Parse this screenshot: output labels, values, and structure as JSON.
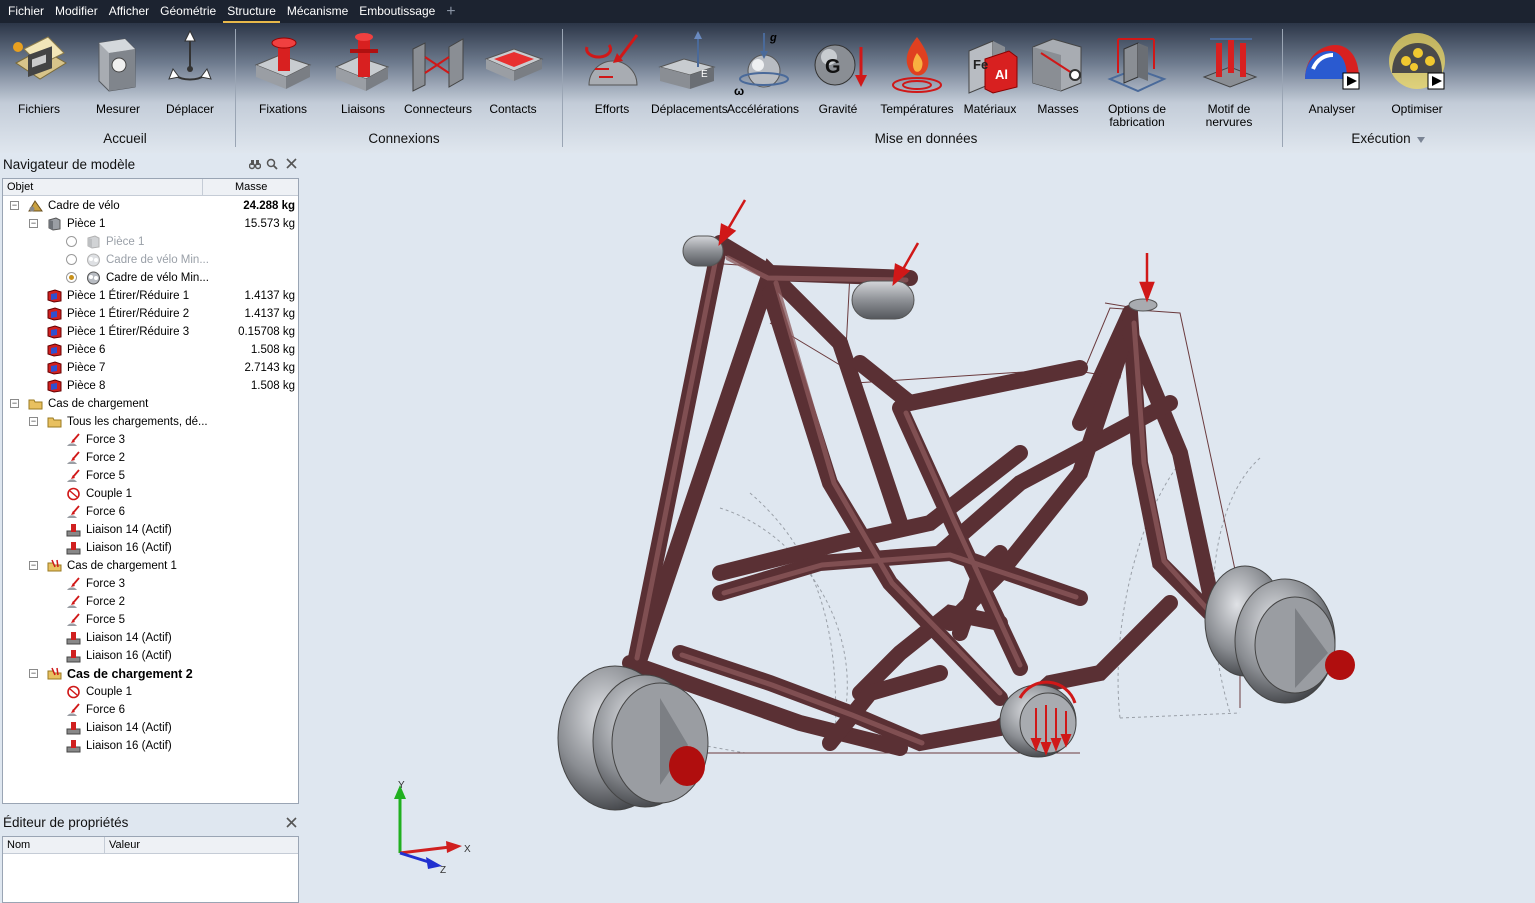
{
  "menu": {
    "items": [
      "Fichier",
      "Modifier",
      "Afficher",
      "Géométrie",
      "Structure",
      "Mécanisme",
      "Emboutissage"
    ],
    "active_index": 4,
    "plus": "+"
  },
  "ribbon": {
    "buttons": {
      "fichiers": "Fichiers",
      "mesurer": "Mesurer",
      "deplacer": "Déplacer",
      "fixations": "Fixations",
      "liaisons": "Liaisons",
      "connecteurs": "Connecteurs",
      "contacts": "Contacts",
      "efforts": "Efforts",
      "deplacements": "Déplacements",
      "accelerations": "Accélérations",
      "gravite": "Gravité",
      "temperatures": "Températures",
      "materiaux": "Matériaux",
      "masses": "Masses",
      "options_fabrication": "Options de fabrication",
      "motif_nervures": "Motif de nervures",
      "analyser": "Analyser",
      "optimiser": "Optimiser"
    },
    "groups": {
      "accueil": "Accueil",
      "connexions": "Connexions",
      "mise": "Mise en données",
      "execution": "Exécution"
    },
    "glyphs": {
      "omega": "ω",
      "g": "g",
      "G": "G",
      "Fe": "Fe",
      "Al": "Al"
    }
  },
  "navigator": {
    "title": "Navigateur de modèle",
    "col_object": "Objet",
    "col_mass": "Masse",
    "rows": [
      {
        "label": "Cadre de vélo",
        "mass": "24.288 kg",
        "level": 0,
        "toggle": "−",
        "icon": "bike-frame-icon",
        "mass_bold": true
      },
      {
        "label": "Pièce 1",
        "mass": "15.573 kg",
        "level": 1,
        "toggle": "−",
        "icon": "gray-part-icon"
      },
      {
        "label": "Pièce 1",
        "mass": "",
        "level": 2,
        "toggle": "",
        "icon": "gray-part-icon",
        "radio": "off",
        "disabled": true
      },
      {
        "label": "Cadre de vélo Min...",
        "mass": "",
        "level": 2,
        "toggle": "",
        "icon": "mesh-part-icon",
        "radio": "off",
        "disabled": true
      },
      {
        "label": "Cadre de vélo Min...",
        "mass": "",
        "level": 2,
        "toggle": "",
        "icon": "mesh-part-icon",
        "radio": "on"
      },
      {
        "label": "Pièce 1 Étirer/Réduire 1",
        "mass": "1.4137 kg",
        "level": 1,
        "toggle": "",
        "icon": "design-part-icon"
      },
      {
        "label": "Pièce 1 Étirer/Réduire 2",
        "mass": "1.4137 kg",
        "level": 1,
        "toggle": "",
        "icon": "design-part-icon"
      },
      {
        "label": "Pièce 1 Étirer/Réduire 3",
        "mass": "0.15708 kg",
        "level": 1,
        "toggle": "",
        "icon": "design-part-icon"
      },
      {
        "label": "Pièce 6",
        "mass": "1.508 kg",
        "level": 1,
        "toggle": "",
        "icon": "design-part-icon"
      },
      {
        "label": "Pièce 7",
        "mass": "2.7143 kg",
        "level": 1,
        "toggle": "",
        "icon": "design-part-icon"
      },
      {
        "label": "Pièce 8",
        "mass": "1.508 kg",
        "level": 1,
        "toggle": "",
        "icon": "design-part-icon"
      },
      {
        "label": "Cas de chargement",
        "mass": "",
        "level": 0,
        "toggle": "−",
        "icon": "folder-icon"
      },
      {
        "label": "Tous les chargements, dé...",
        "mass": "",
        "level": 1,
        "toggle": "−",
        "icon": "folder-icon"
      },
      {
        "label": "Force 3",
        "mass": "",
        "level": 2,
        "toggle": "",
        "icon": "force-icon"
      },
      {
        "label": "Force 2",
        "mass": "",
        "level": 2,
        "toggle": "",
        "icon": "force-icon"
      },
      {
        "label": "Force 5",
        "mass": "",
        "level": 2,
        "toggle": "",
        "icon": "force-icon"
      },
      {
        "label": "Couple 1",
        "mass": "",
        "level": 2,
        "toggle": "",
        "icon": "torque-icon"
      },
      {
        "label": "Force 6",
        "mass": "",
        "level": 2,
        "toggle": "",
        "icon": "force-icon"
      },
      {
        "label": "Liaison 14 (Actif)",
        "mass": "",
        "level": 2,
        "toggle": "",
        "icon": "support-icon"
      },
      {
        "label": "Liaison 16 (Actif)",
        "mass": "",
        "level": 2,
        "toggle": "",
        "icon": "support-icon"
      },
      {
        "label": "Cas de chargement 1",
        "mass": "",
        "level": 1,
        "toggle": "−",
        "icon": "load-case-icon"
      },
      {
        "label": "Force 3",
        "mass": "",
        "level": 2,
        "toggle": "",
        "icon": "force-icon"
      },
      {
        "label": "Force 2",
        "mass": "",
        "level": 2,
        "toggle": "",
        "icon": "force-icon"
      },
      {
        "label": "Force 5",
        "mass": "",
        "level": 2,
        "toggle": "",
        "icon": "force-icon"
      },
      {
        "label": "Liaison 14 (Actif)",
        "mass": "",
        "level": 2,
        "toggle": "",
        "icon": "support-icon"
      },
      {
        "label": "Liaison 16 (Actif)",
        "mass": "",
        "level": 2,
        "toggle": "",
        "icon": "support-icon"
      },
      {
        "label": "Cas de chargement 2",
        "mass": "",
        "level": 1,
        "toggle": "−",
        "icon": "load-case-icon",
        "bold": true
      },
      {
        "label": "Couple 1",
        "mass": "",
        "level": 2,
        "toggle": "",
        "icon": "torque-icon"
      },
      {
        "label": "Force 6",
        "mass": "",
        "level": 2,
        "toggle": "",
        "icon": "force-icon"
      },
      {
        "label": "Liaison 14 (Actif)",
        "mass": "",
        "level": 2,
        "toggle": "",
        "icon": "support-icon"
      },
      {
        "label": "Liaison 16 (Actif)",
        "mass": "",
        "level": 2,
        "toggle": "",
        "icon": "support-icon"
      }
    ]
  },
  "properties": {
    "title": "Éditeur de propriétés",
    "col_name": "Nom",
    "col_value": "Valeur"
  },
  "triad": {
    "x": "X",
    "y": "Y",
    "z": "Z"
  },
  "colors": {
    "frame": "#6b3b3e",
    "frame_light": "#9a6a6a",
    "force": "#d01818",
    "accent_tab": "#e8b84a",
    "viewport_bg": "#dfe7f0"
  }
}
